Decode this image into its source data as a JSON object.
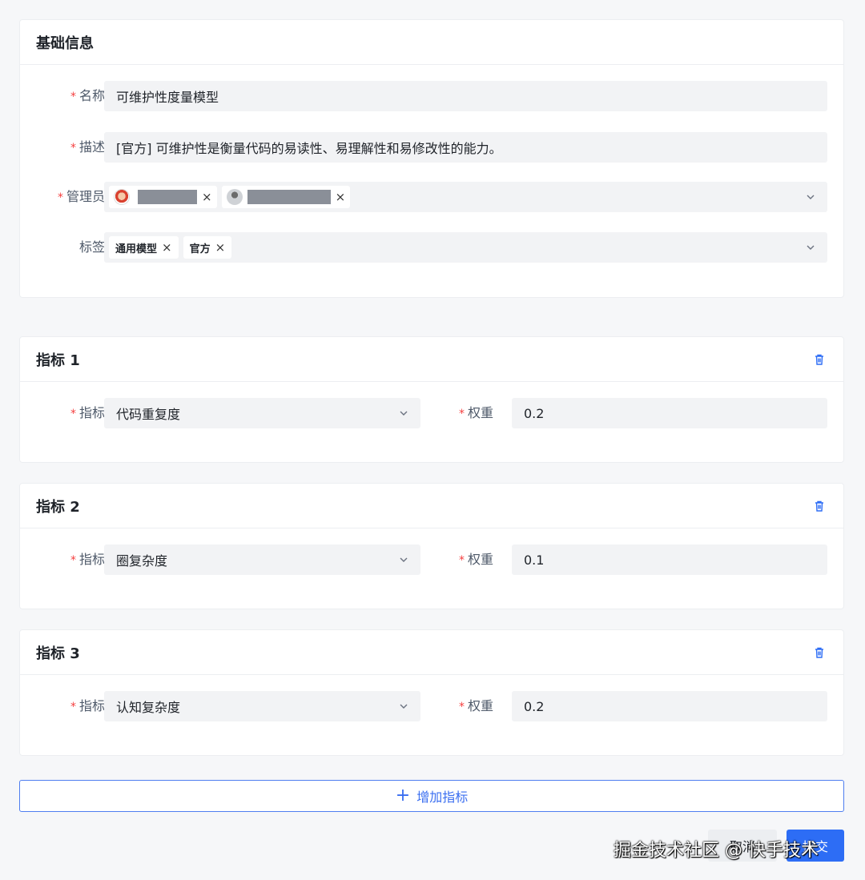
{
  "basic": {
    "title": "基础信息",
    "name_label": "名称",
    "name_value": "可维护性度量模型",
    "desc_label": "描述",
    "desc_value": "[官方] 可维护性是衡量代码的易读性、易理解性和易修改性的能力。",
    "admin_label": "管理员",
    "admins": [
      {
        "name": "",
        "remove": "×"
      },
      {
        "name": "",
        "remove": "×"
      }
    ],
    "tags_label": "标签",
    "tags": [
      {
        "label": "通用模型",
        "remove": "×"
      },
      {
        "label": "官方",
        "remove": "×"
      }
    ]
  },
  "metrics": [
    {
      "title": "指标 1",
      "metric_label": "指标",
      "metric_value": "代码重复度",
      "weight_label": "权重",
      "weight_value": "0.2"
    },
    {
      "title": "指标 2",
      "metric_label": "指标",
      "metric_value": "圈复杂度",
      "weight_label": "权重",
      "weight_value": "0.1"
    },
    {
      "title": "指标 3",
      "metric_label": "指标",
      "metric_value": "认知复杂度",
      "weight_label": "权重",
      "weight_value": "0.2"
    }
  ],
  "required_mark": "*",
  "add_button": {
    "icon": "plus-icon",
    "label": "增加指标"
  },
  "footer": {
    "cancel_label": "取消",
    "submit_label": "提交",
    "watermark": "掘金技术社区 @ 快手技术"
  },
  "colors": {
    "accent": "#2d6df5",
    "required": "#f53f3f",
    "field_bg": "#f2f3f5",
    "page_bg": "#f6f7f9"
  }
}
